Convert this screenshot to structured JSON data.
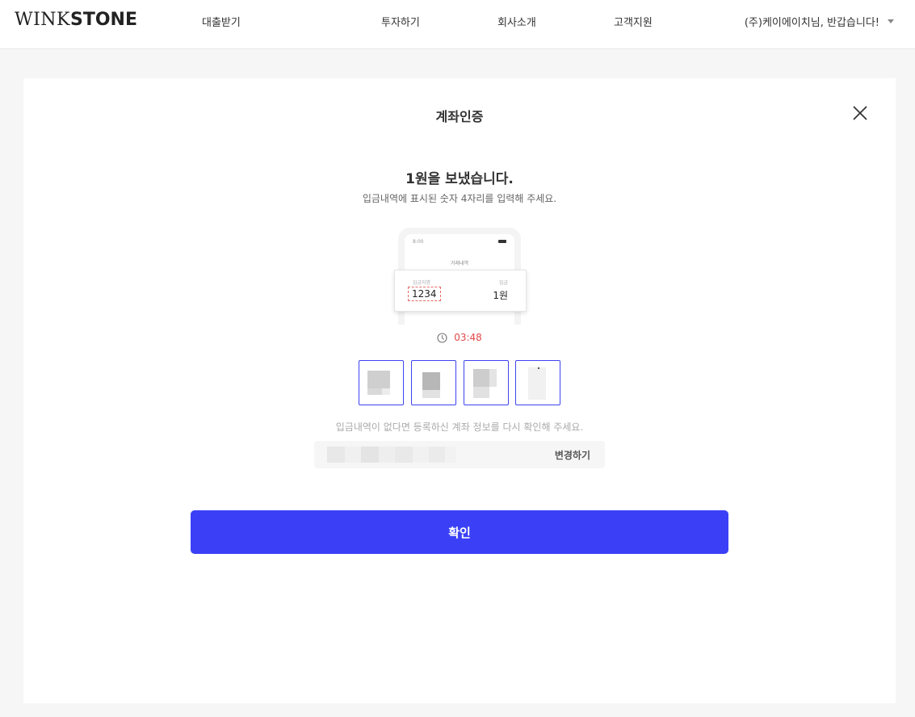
{
  "header": {
    "logo_light": "WINK",
    "logo_bold": "STONE",
    "nav": [
      {
        "label": "대출받기"
      },
      {
        "label": "투자하기"
      },
      {
        "label": "회사소개"
      },
      {
        "label": "고객지원"
      }
    ],
    "user_greeting": "(주)케이에이치님, 반갑습니다!"
  },
  "modal": {
    "title": "계좌인증",
    "headline": "1원을 보냈습니다.",
    "subline": "입금내역에 표시된 숫자 4자리를 입력해 주세요.",
    "illustration": {
      "time": "8:00",
      "heading": "거래내역",
      "left_label": "입금자명",
      "right_label": "입금",
      "code": "1234",
      "amount": "1원"
    },
    "timer": "03:48",
    "notice": "입금내역이 없다면 등록하신 계좌 정보를 다시 확인해 주세요.",
    "change_label": "변경하기",
    "confirm_label": "확인"
  },
  "colors": {
    "accent": "#3b40f6",
    "timer": "#e04848",
    "code_box_border": "#3c44f0"
  }
}
